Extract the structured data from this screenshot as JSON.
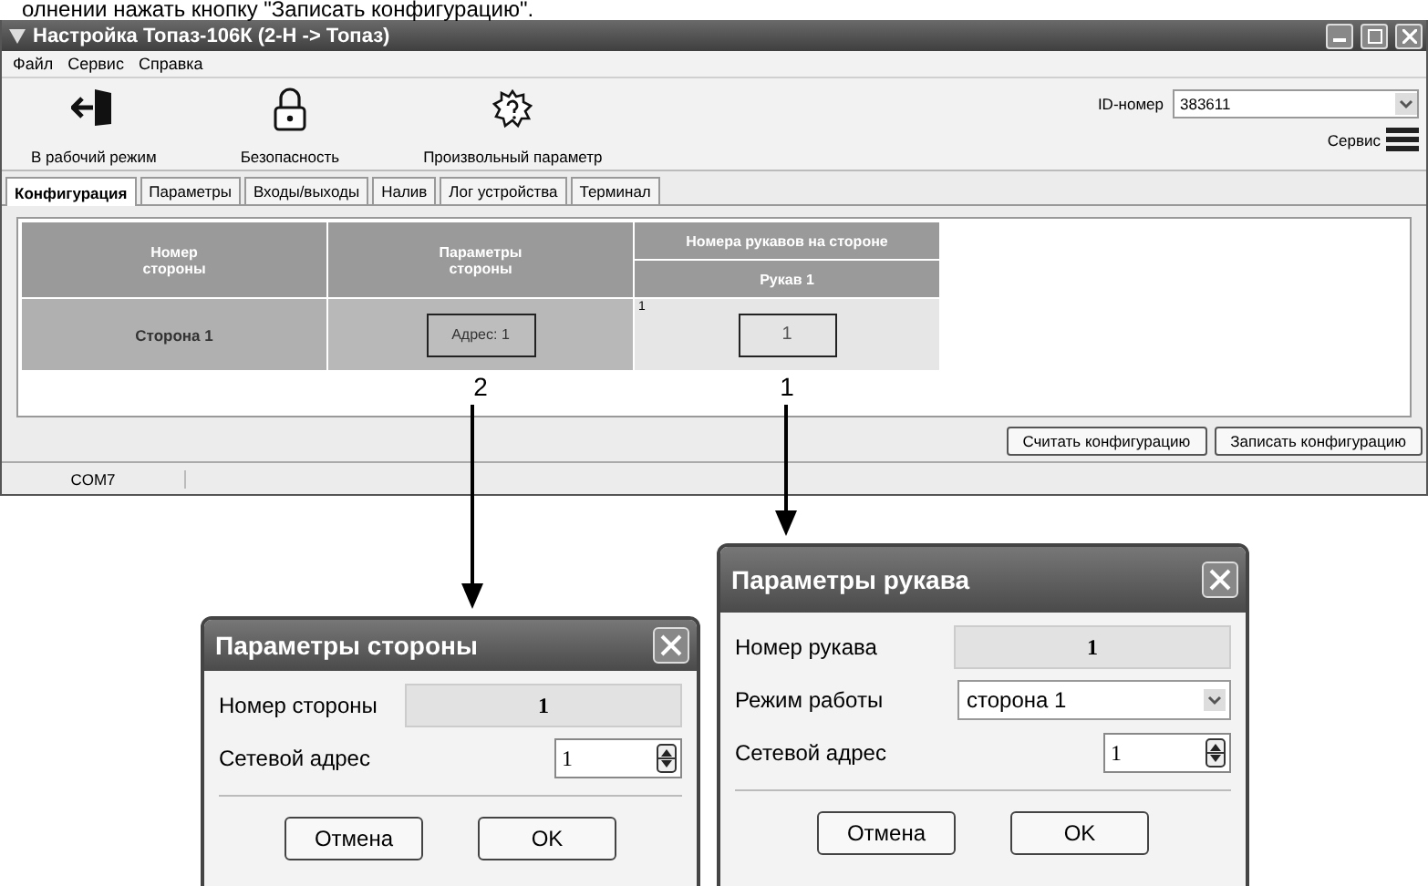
{
  "caption": "олнении нажать кнопку \"Записать конфигурацию\".",
  "window": {
    "title": "Настройка Топаз-106К (2-Н -> Топаз)"
  },
  "menu": [
    "Файл",
    "Сервис",
    "Справка"
  ],
  "toolbar": [
    {
      "kind": "exit",
      "label": "В рабочий режим"
    },
    {
      "kind": "lock",
      "label": "Безопасность"
    },
    {
      "kind": "gear",
      "label": "Произвольный параметр"
    }
  ],
  "id_field": {
    "label": "ID-номер",
    "value": "383611"
  },
  "service": {
    "label": "Сервис"
  },
  "tabs": [
    {
      "label": "Конфигурация",
      "selected": true
    },
    {
      "label": "Параметры",
      "selected": false
    },
    {
      "label": "Входы/выходы",
      "selected": false
    },
    {
      "label": "Налив",
      "selected": false
    },
    {
      "label": "Лог устройства",
      "selected": false
    },
    {
      "label": "Терминал",
      "selected": false
    }
  ],
  "table": {
    "columns": [
      "Номер стороны",
      "Параметры стороны"
    ],
    "group_header": "Номера рукавов на стороне",
    "sub_columns": [
      "Рукав 1"
    ],
    "rows": [
      {
        "side": "Сторона 1",
        "address": "Адрес: 1",
        "hoses": [
          {
            "index": "1",
            "value": "1"
          }
        ]
      }
    ]
  },
  "callouts": [
    "2",
    "1"
  ],
  "buttons": [
    "Считать конфигурацию",
    "Записать конфигурацию"
  ],
  "status_bar": [
    "COM7"
  ],
  "dialogs": [
    {
      "title": "Параметры стороны",
      "fields": [
        {
          "kind": "readonly",
          "label": "Номер стороны",
          "value": "1"
        },
        {
          "kind": "spin",
          "label": "Сетевой адрес",
          "value": "1"
        }
      ],
      "buttons": [
        "Отмена",
        "OK"
      ]
    },
    {
      "title": "Параметры рукава",
      "fields": [
        {
          "kind": "readonly",
          "label": "Номер рукава",
          "value": "1"
        },
        {
          "kind": "select",
          "label": "Режим работы",
          "value": "сторона 1"
        },
        {
          "kind": "spin",
          "label": "Сетевой адрес",
          "value": "1"
        }
      ],
      "buttons": [
        "Отмена",
        "OK"
      ]
    }
  ]
}
